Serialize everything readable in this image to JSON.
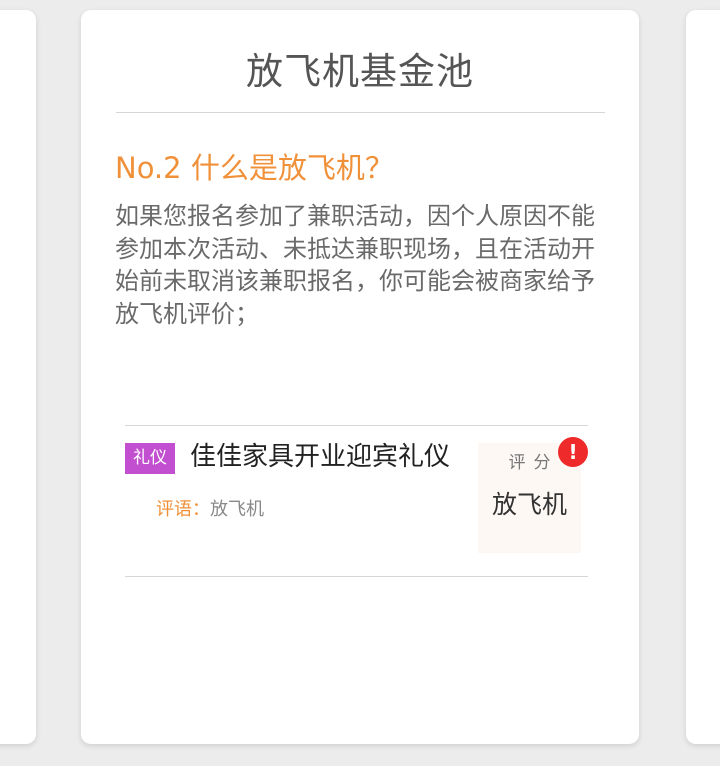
{
  "card": {
    "title": "放飞机基金池",
    "question": {
      "heading": "No.2 什么是放飞机？",
      "body": "如果您报名参加了兼职活动，因个人原因不能参加本次活动、未抵达兼职现场，且在活动开始前未取消该兼职报名，你可能会被商家给予放飞机评价；"
    },
    "example": {
      "tag": "礼仪",
      "job_title": "佳佳家具开业迎宾礼仪",
      "comment_label": "评语：",
      "comment_value": "放飞机",
      "score_label": "评分",
      "score_value": "放飞机",
      "alert_glyph": "!"
    }
  },
  "colors": {
    "accent_orange": "#f0913a",
    "tag_purple": "#c24fd0",
    "alert_red": "#ee2a2a"
  },
  "icons": {
    "alert": "exclamation-icon"
  }
}
